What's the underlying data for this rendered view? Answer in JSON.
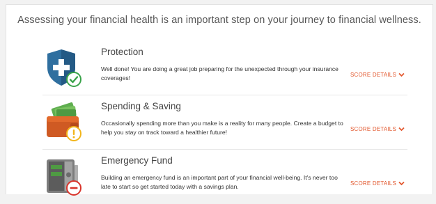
{
  "headline": "Assessing your financial health is an important step on your journey to financial wellness.",
  "colors": {
    "accent": "#e2562c",
    "success": "#3aa34a",
    "warning": "#f2b51b",
    "danger": "#d9342b"
  },
  "rows": [
    {
      "title": "Protection",
      "description": "Well done! You are doing a great job preparing for the unexpected through your insurance coverages!",
      "score_link": "SCORE DETAILS",
      "icon": "shield-plus-icon",
      "status_icon": "check-circle-icon"
    },
    {
      "title": "Spending & Saving",
      "description": "Occasionally spending more than you make is a reality for many people. Create a budget to help you stay on track toward a healthier future!",
      "score_link": "SCORE DETAILS",
      "icon": "wallet-cash-icon",
      "status_icon": "warning-circle-icon"
    },
    {
      "title": "Emergency Fund",
      "description": "Building an emergency fund is an important part of your financial well-being. It's never too late to start so get started today with a savings plan.",
      "score_link": "SCORE DETAILS",
      "icon": "safe-icon",
      "status_icon": "minus-circle-icon"
    }
  ]
}
